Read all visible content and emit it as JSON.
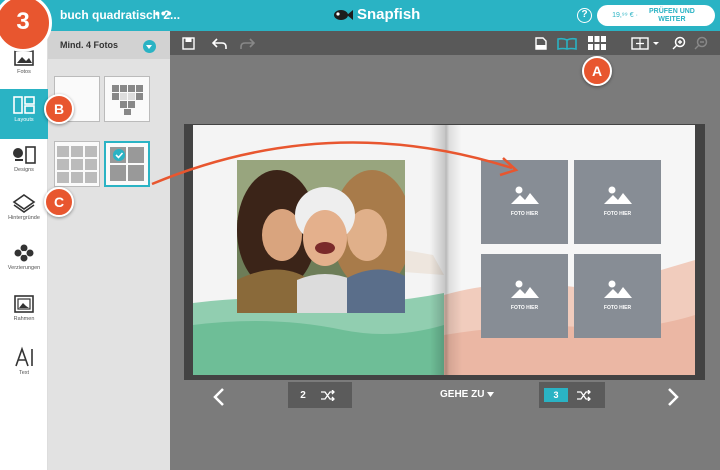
{
  "step_number": "3",
  "header": {
    "project_title": "buch quadratisch 2...",
    "more_glyph": "•••",
    "logo_text": "Snapfish",
    "help_glyph": "?",
    "price": "19,⁹⁹ € ·",
    "checkout_label": "PRÜFEN UND WEITER",
    "accent_color": "#2ab3c4"
  },
  "sidebar": {
    "items": [
      {
        "label": "Fotos",
        "icon": "photos-icon"
      },
      {
        "label": "Layouts",
        "icon": "layouts-icon",
        "active": true
      },
      {
        "label": "Designs",
        "icon": "designs-icon"
      },
      {
        "label": "Hintergründe",
        "icon": "backgrounds-icon"
      },
      {
        "label": "Verzierungen",
        "icon": "embellishments-icon"
      },
      {
        "label": "Rahmen",
        "icon": "frames-icon"
      },
      {
        "label": "Text",
        "icon": "text-icon"
      }
    ]
  },
  "layout_panel": {
    "title": "Mind. 4 Fotos"
  },
  "markers": {
    "a": "A",
    "b": "B",
    "c": "C",
    "color": "#e8562f"
  },
  "canvas": {
    "placeholder_label": "FOTO HIER",
    "left_page_number": "2",
    "right_page_number": "3",
    "goto_label": "GEHE ZU"
  }
}
